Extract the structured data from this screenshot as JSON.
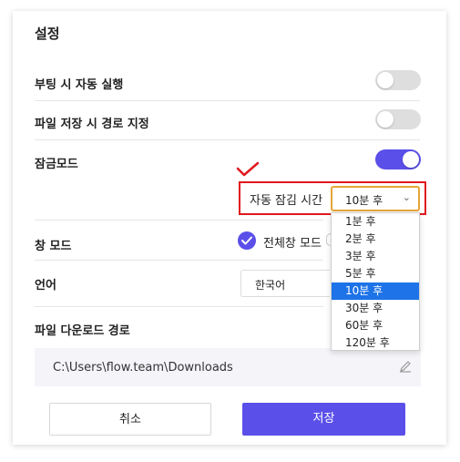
{
  "dialog": {
    "title": "설정"
  },
  "settings": {
    "auto_run": {
      "label": "부팅 시 자동 실행",
      "enabled": false
    },
    "save_path": {
      "label": "파일 저장 시 경로 지정",
      "enabled": false
    },
    "lock_mode": {
      "label": "잠금모드",
      "enabled": true
    },
    "auto_lock": {
      "label": "자동 잠김 시간",
      "selected": "10분 후",
      "options": [
        "1분 후",
        "2분 후",
        "3분 후",
        "5분 후",
        "10분 후",
        "30분 후",
        "60분 후",
        "120분 후"
      ]
    },
    "window_mode": {
      "label": "창 모드",
      "option_label": "전체창 모드"
    },
    "language": {
      "label": "언어",
      "selected": "한국어"
    },
    "download_path": {
      "label": "파일 다운로드 경로",
      "value": "C:\\Users\\flow.team\\Downloads"
    }
  },
  "buttons": {
    "cancel": "취소",
    "save": "저장"
  },
  "colors": {
    "accent": "#5b4fe9",
    "highlight": "#e0181e",
    "selected_option": "#1e73e8"
  }
}
